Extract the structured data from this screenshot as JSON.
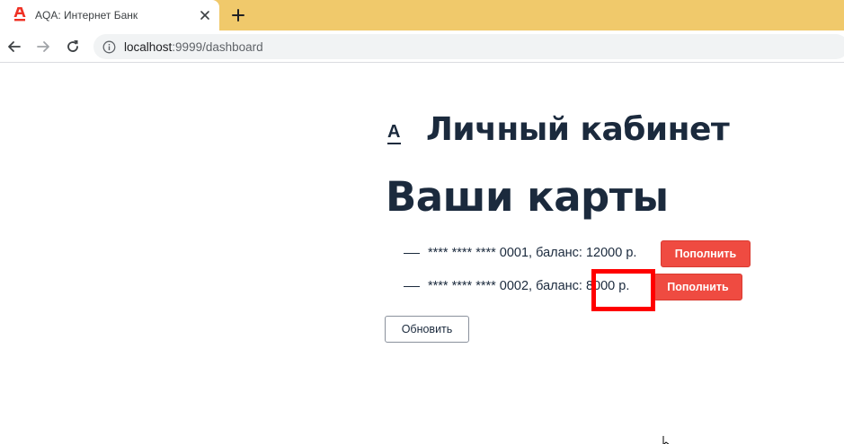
{
  "browser": {
    "tab_title": "AQA: Интернет Банк",
    "url_host": "localhost",
    "url_rest": ":9999/dashboard",
    "favicon": "alfa-a-icon",
    "accent_color": "#f0c96b"
  },
  "page": {
    "logo_letter": "A",
    "title": "Личный кабинет",
    "cards_heading": "Ваши карты",
    "cards": [
      {
        "text": "**** **** **** 0001, баланс: 12000 р.",
        "button": "Пополнить"
      },
      {
        "text": "**** **** **** 0002, баланс: 8000 р.",
        "button": "Пополнить"
      }
    ],
    "refresh_button": "Обновить",
    "button_color": "#ef4b41",
    "highlight_color": "#ff0000"
  }
}
